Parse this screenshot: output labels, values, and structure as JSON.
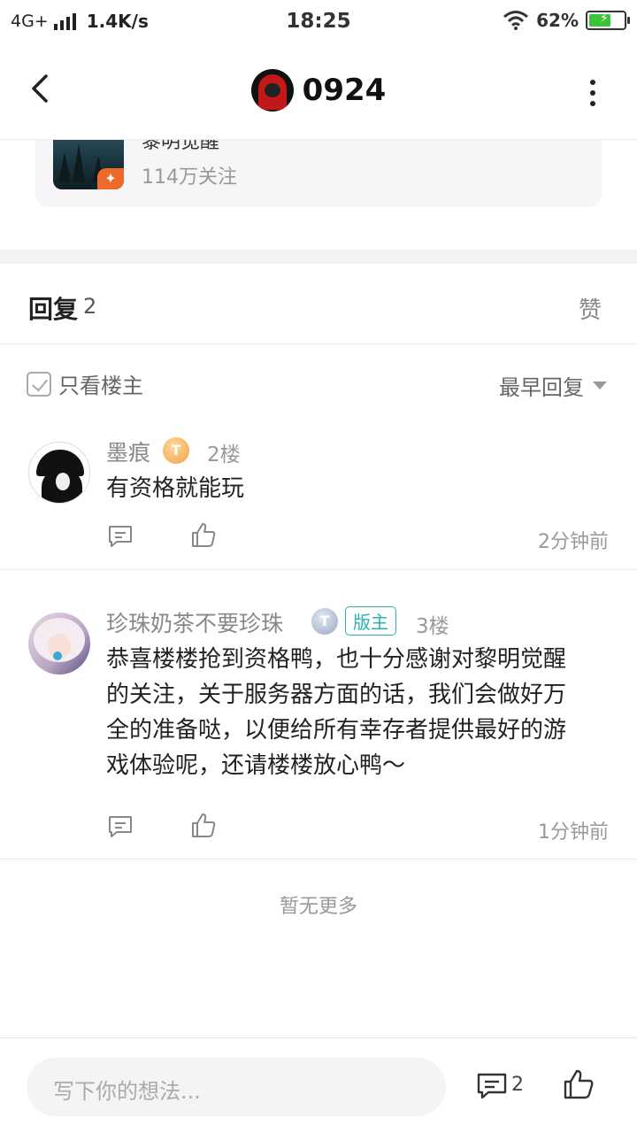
{
  "status_bar": {
    "network": "4G+",
    "speed": "1.4K/s",
    "time": "18:25",
    "battery": "62%"
  },
  "header": {
    "title": "0924"
  },
  "forum_card": {
    "name": "黎明觉醒",
    "followers": "114万关注"
  },
  "replies": {
    "label": "回复",
    "count": "2",
    "like_tab": "赞",
    "only_op": "只看楼主",
    "sort": "最早回复"
  },
  "posts": [
    {
      "username": "墨痕",
      "level_icon": "T",
      "floor": "2楼",
      "content_lines": [
        "有资格就能玩"
      ],
      "time": "2分钟前"
    },
    {
      "username": "珍珠奶茶不要珍珠",
      "level_icon": "T",
      "badge": "版主",
      "floor": "3楼",
      "content_lines": [
        "恭喜楼楼抢到资格鸭，也十分感谢对黎明觉醒",
        "的关注，关于服务器方面的话，我们会做好万",
        "全的准备哒，以便给所有幸存者提供最好的游",
        "戏体验呢，还请楼楼放心鸭～"
      ],
      "time": "1分钟前"
    }
  ],
  "no_more": "暂无更多",
  "bottom_bar": {
    "input_placeholder": "写下你的想法...",
    "comment_count": "2"
  },
  "colors": {
    "moderator": "#2ab4b0",
    "battery": "#39c43a"
  }
}
